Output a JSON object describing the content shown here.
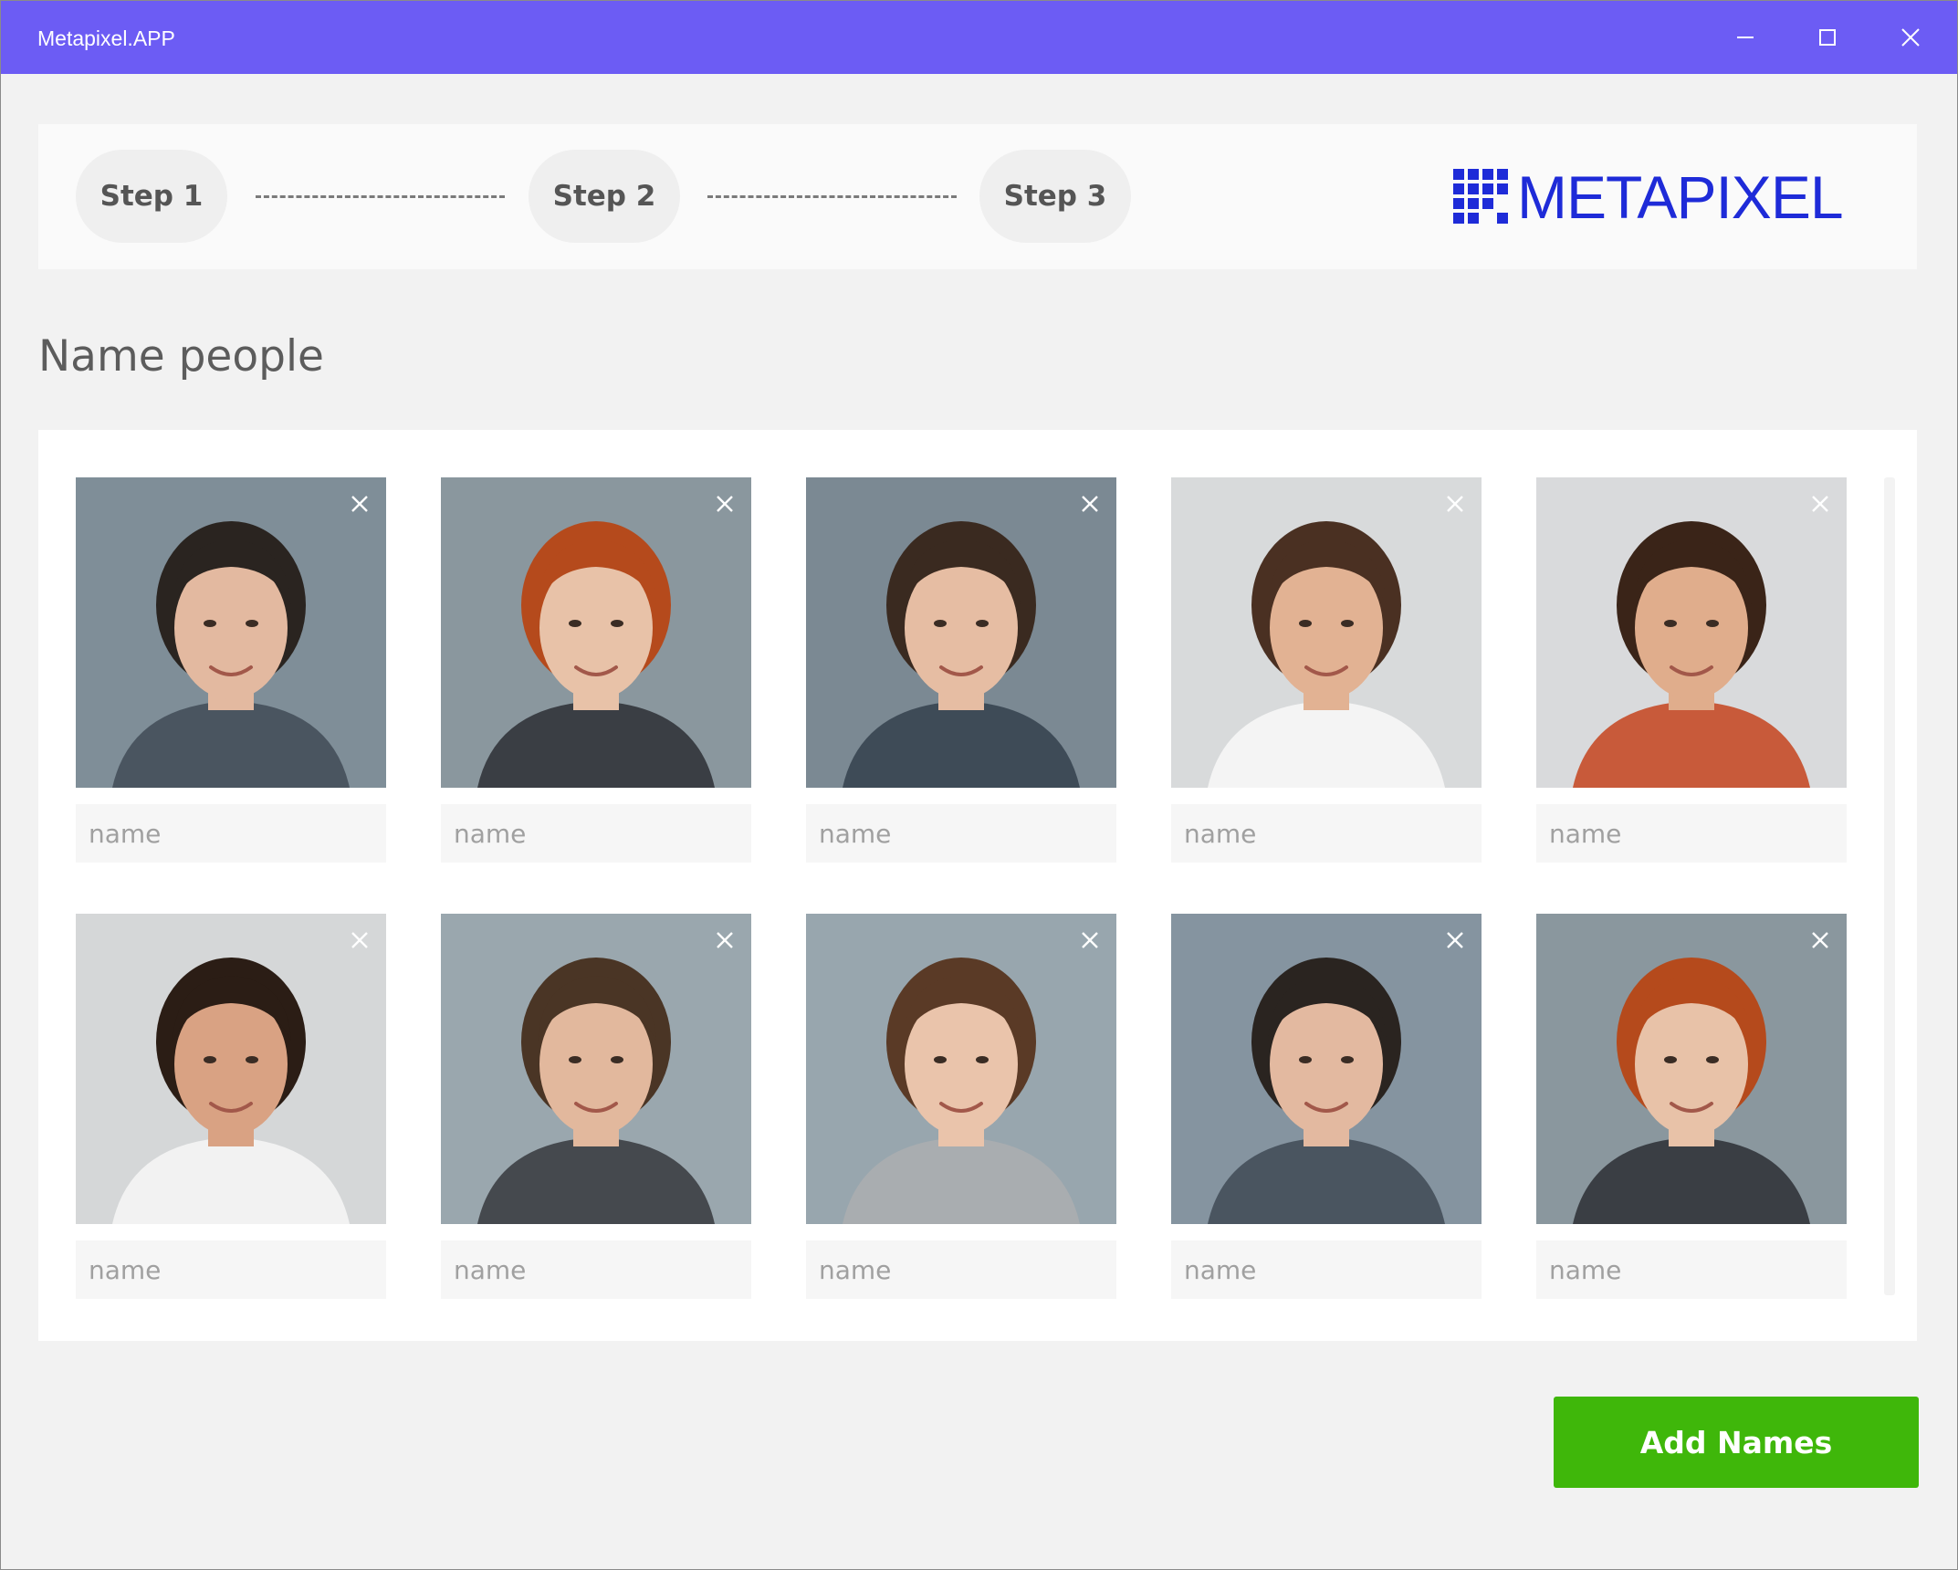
{
  "window": {
    "title": "Metapixel.APP",
    "titlebar_color": "#6c5cf4",
    "controls": [
      "minimize-icon",
      "maximize-icon",
      "close-icon"
    ]
  },
  "steps": [
    {
      "label": "Step 1"
    },
    {
      "label": "Step 2"
    },
    {
      "label": "Step 3"
    }
  ],
  "logo": {
    "text": "METAPIXEL",
    "color": "#1e2bd8"
  },
  "heading": "Name people",
  "people": [
    {
      "placeholder": "name",
      "value": "",
      "hair": "#2a2420",
      "skin": "#e3b9a0",
      "bg": "#7f8e98",
      "shirt": "#4a5560"
    },
    {
      "placeholder": "name",
      "value": "",
      "hair": "#b54a1c",
      "skin": "#e8c2a8",
      "bg": "#8a979e",
      "shirt": "#3a3e44"
    },
    {
      "placeholder": "name",
      "value": "",
      "hair": "#3a2a20",
      "skin": "#e6bda3",
      "bg": "#7b8993",
      "shirt": "#3e4b57"
    },
    {
      "placeholder": "name",
      "value": "",
      "hair": "#4a3022",
      "skin": "#e2b293",
      "bg": "#d8dadb",
      "shirt": "#f4f4f4"
    },
    {
      "placeholder": "name",
      "value": "",
      "hair": "#3a2418",
      "skin": "#e0ad8c",
      "bg": "#d9dadc",
      "shirt": "#c85a3a"
    },
    {
      "placeholder": "name",
      "value": "",
      "hair": "#2b1d15",
      "skin": "#d9a283",
      "bg": "#d5d7d8",
      "shirt": "#f2f2f2"
    },
    {
      "placeholder": "name",
      "value": "",
      "hair": "#4a3525",
      "skin": "#e2b89d",
      "bg": "#9aa7ae",
      "shirt": "#45494e"
    },
    {
      "placeholder": "name",
      "value": "",
      "hair": "#5a3a26",
      "skin": "#eac4ab",
      "bg": "#98a6ae",
      "shirt": "#a9adb0"
    },
    {
      "placeholder": "name",
      "value": "",
      "hair": "#2a2420",
      "skin": "#e3b9a0",
      "bg": "#8594a0",
      "shirt": "#4a5560"
    },
    {
      "placeholder": "name",
      "value": "",
      "hair": "#b54a1c",
      "skin": "#e8c2a8",
      "bg": "#8a979e",
      "shirt": "#3a3e44"
    }
  ],
  "actions": {
    "add_names_label": "Add Names",
    "add_names_color": "#3fb70a"
  }
}
